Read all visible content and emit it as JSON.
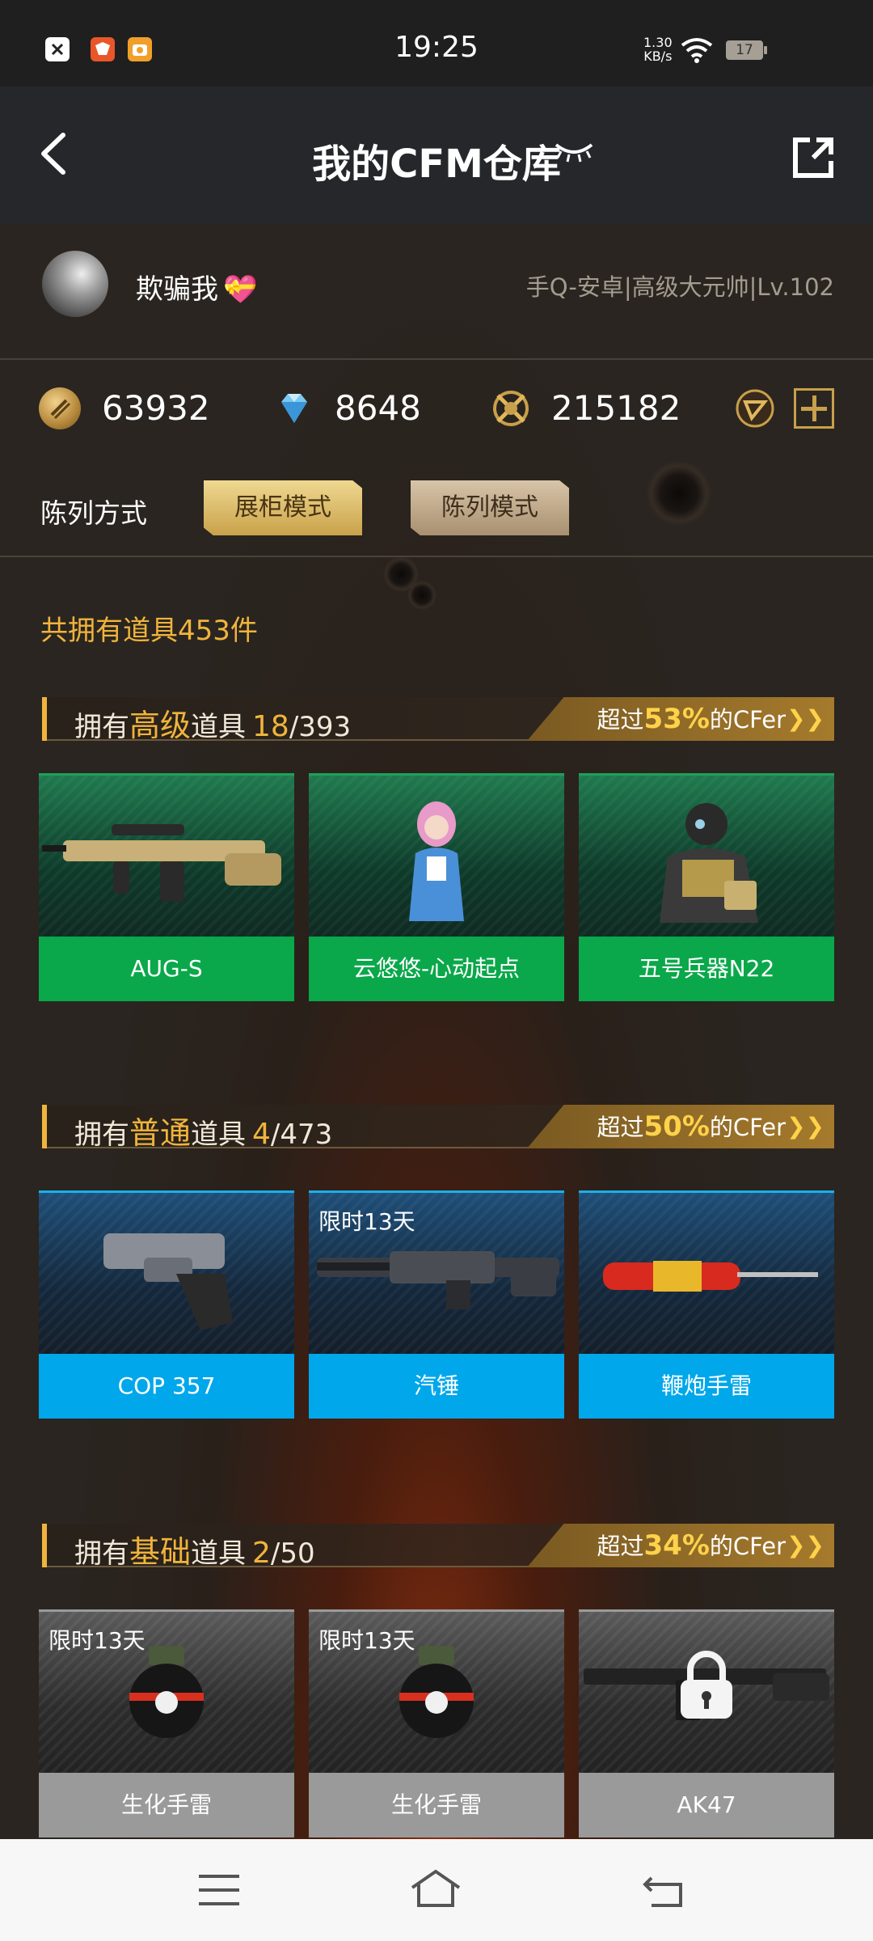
{
  "status_bar": {
    "time": "19:25",
    "net_speed_value": "1.30",
    "net_speed_unit": "KB/s",
    "battery": "17",
    "icons": [
      "close-app-icon",
      "game-app-icon",
      "camera-app-icon",
      "wifi-icon",
      "battery-icon"
    ]
  },
  "header": {
    "title": "我的CFM仓库",
    "back_icon": "chevron-left-icon",
    "eye_icon": "eye-closed-icon",
    "share_icon": "share-icon"
  },
  "profile": {
    "username": "欺骗我",
    "username_emoji": "💝",
    "account_info": "手Q-安卓|高级大元帅|Lv.102"
  },
  "currency": {
    "gold": "63932",
    "diamond": "8648",
    "cf_points": "215182",
    "icons": [
      "gold-coin-icon",
      "diamond-icon",
      "cf-points-icon",
      "honor-icon",
      "add-icon"
    ]
  },
  "arrange": {
    "label": "陈列方式",
    "mode_showcase": "展柜模式",
    "mode_display": "陈列模式"
  },
  "summary": {
    "total_items": "共拥有道具453件"
  },
  "sections": [
    {
      "prefix": "拥有",
      "tier": "高级",
      "suffix": "道具",
      "count": "18",
      "total": "/393",
      "rank_prefix": "超过",
      "rank_pct": "53%",
      "rank_suffix": "的CFer",
      "color": "#0aa84a",
      "items": [
        {
          "name": "AUG-S",
          "limit": ""
        },
        {
          "name": "云悠悠-心动起点",
          "limit": ""
        },
        {
          "name": "五号兵器N22",
          "limit": ""
        }
      ]
    },
    {
      "prefix": "拥有",
      "tier": "普通",
      "suffix": "道具",
      "count": "4",
      "total": "/473",
      "rank_prefix": "超过",
      "rank_pct": "50%",
      "rank_suffix": "的CFer",
      "color": "#00a7ea",
      "items": [
        {
          "name": "COP 357",
          "limit": ""
        },
        {
          "name": "汽锤",
          "limit": "限时13天"
        },
        {
          "name": "鞭炮手雷",
          "limit": ""
        }
      ]
    },
    {
      "prefix": "拥有",
      "tier": "基础",
      "suffix": "道具",
      "count": "2",
      "total": "/50",
      "rank_prefix": "超过",
      "rank_pct": "34%",
      "rank_suffix": "的CFer",
      "color": "#9a9a9a",
      "items": [
        {
          "name": "生化手雷",
          "limit": "限时13天"
        },
        {
          "name": "生化手雷",
          "limit": "限时13天"
        },
        {
          "name": "AK47",
          "limit": ""
        }
      ]
    }
  ],
  "nav": {
    "icons": [
      "menu-icon",
      "home-icon",
      "back-icon"
    ]
  },
  "colors": {
    "accent": "#f0b43c",
    "header_bg": "#26272b",
    "green": "#0aa84a",
    "blue": "#00a7ea",
    "gray": "#9a9a9a"
  }
}
